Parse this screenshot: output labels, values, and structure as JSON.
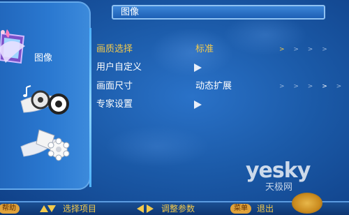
{
  "title_bar": {
    "title": "图像"
  },
  "sidebar": {
    "active_category_label": "图像",
    "categories": [
      {
        "icon": "picture-icon"
      },
      {
        "icon": "sound-icon"
      },
      {
        "icon": "setup-icon"
      }
    ]
  },
  "menu": {
    "items": [
      {
        "label": "画质选择",
        "value": "标准",
        "scale": "> > > >",
        "selected": true
      },
      {
        "label": "用户自定义",
        "value": "",
        "has_submenu": true,
        "selected": false
      },
      {
        "label": "画面尺寸",
        "value": "动态扩展",
        "scale": "> > > > >",
        "selected": false
      },
      {
        "label": "专家设置",
        "value": "",
        "has_submenu": true,
        "selected": false
      }
    ]
  },
  "footer": {
    "help_pill": "帮助",
    "select_item": "选择项目",
    "adjust_param": "调整参数",
    "menu_pill": "菜单",
    "exit": "退出"
  },
  "watermark": {
    "logo": "yesky",
    "sub": "天极网"
  },
  "colors": {
    "background": "#1b5aa8",
    "selected_text": "#f2c94c",
    "normal_text": "#ffffff",
    "title_bar": "#2a6fc4"
  }
}
